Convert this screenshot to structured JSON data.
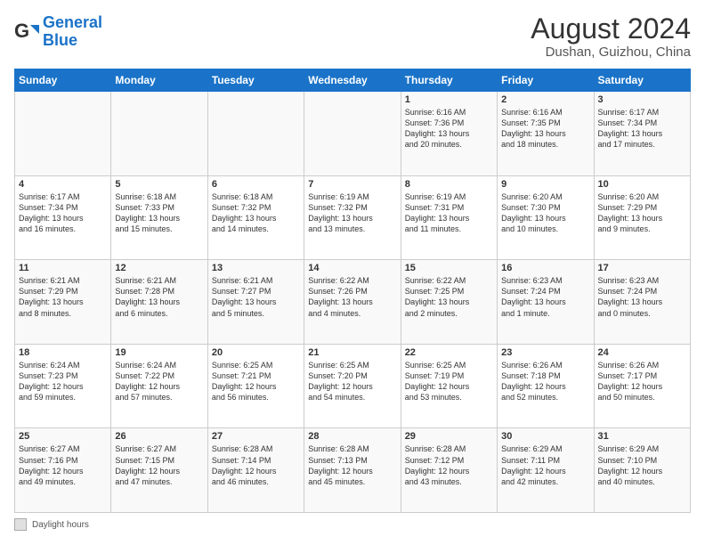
{
  "logo": {
    "general": "General",
    "blue": "Blue"
  },
  "header": {
    "title": "August 2024",
    "subtitle": "Dushan, Guizhou, China"
  },
  "days": [
    "Sunday",
    "Monday",
    "Tuesday",
    "Wednesday",
    "Thursday",
    "Friday",
    "Saturday"
  ],
  "weeks": [
    [
      {
        "day": "",
        "content": ""
      },
      {
        "day": "",
        "content": ""
      },
      {
        "day": "",
        "content": ""
      },
      {
        "day": "",
        "content": ""
      },
      {
        "day": "1",
        "content": "Sunrise: 6:16 AM\nSunset: 7:36 PM\nDaylight: 13 hours\nand 20 minutes."
      },
      {
        "day": "2",
        "content": "Sunrise: 6:16 AM\nSunset: 7:35 PM\nDaylight: 13 hours\nand 18 minutes."
      },
      {
        "day": "3",
        "content": "Sunrise: 6:17 AM\nSunset: 7:34 PM\nDaylight: 13 hours\nand 17 minutes."
      }
    ],
    [
      {
        "day": "4",
        "content": "Sunrise: 6:17 AM\nSunset: 7:34 PM\nDaylight: 13 hours\nand 16 minutes."
      },
      {
        "day": "5",
        "content": "Sunrise: 6:18 AM\nSunset: 7:33 PM\nDaylight: 13 hours\nand 15 minutes."
      },
      {
        "day": "6",
        "content": "Sunrise: 6:18 AM\nSunset: 7:32 PM\nDaylight: 13 hours\nand 14 minutes."
      },
      {
        "day": "7",
        "content": "Sunrise: 6:19 AM\nSunset: 7:32 PM\nDaylight: 13 hours\nand 13 minutes."
      },
      {
        "day": "8",
        "content": "Sunrise: 6:19 AM\nSunset: 7:31 PM\nDaylight: 13 hours\nand 11 minutes."
      },
      {
        "day": "9",
        "content": "Sunrise: 6:20 AM\nSunset: 7:30 PM\nDaylight: 13 hours\nand 10 minutes."
      },
      {
        "day": "10",
        "content": "Sunrise: 6:20 AM\nSunset: 7:29 PM\nDaylight: 13 hours\nand 9 minutes."
      }
    ],
    [
      {
        "day": "11",
        "content": "Sunrise: 6:21 AM\nSunset: 7:29 PM\nDaylight: 13 hours\nand 8 minutes."
      },
      {
        "day": "12",
        "content": "Sunrise: 6:21 AM\nSunset: 7:28 PM\nDaylight: 13 hours\nand 6 minutes."
      },
      {
        "day": "13",
        "content": "Sunrise: 6:21 AM\nSunset: 7:27 PM\nDaylight: 13 hours\nand 5 minutes."
      },
      {
        "day": "14",
        "content": "Sunrise: 6:22 AM\nSunset: 7:26 PM\nDaylight: 13 hours\nand 4 minutes."
      },
      {
        "day": "15",
        "content": "Sunrise: 6:22 AM\nSunset: 7:25 PM\nDaylight: 13 hours\nand 2 minutes."
      },
      {
        "day": "16",
        "content": "Sunrise: 6:23 AM\nSunset: 7:24 PM\nDaylight: 13 hours\nand 1 minute."
      },
      {
        "day": "17",
        "content": "Sunrise: 6:23 AM\nSunset: 7:24 PM\nDaylight: 13 hours\nand 0 minutes."
      }
    ],
    [
      {
        "day": "18",
        "content": "Sunrise: 6:24 AM\nSunset: 7:23 PM\nDaylight: 12 hours\nand 59 minutes."
      },
      {
        "day": "19",
        "content": "Sunrise: 6:24 AM\nSunset: 7:22 PM\nDaylight: 12 hours\nand 57 minutes."
      },
      {
        "day": "20",
        "content": "Sunrise: 6:25 AM\nSunset: 7:21 PM\nDaylight: 12 hours\nand 56 minutes."
      },
      {
        "day": "21",
        "content": "Sunrise: 6:25 AM\nSunset: 7:20 PM\nDaylight: 12 hours\nand 54 minutes."
      },
      {
        "day": "22",
        "content": "Sunrise: 6:25 AM\nSunset: 7:19 PM\nDaylight: 12 hours\nand 53 minutes."
      },
      {
        "day": "23",
        "content": "Sunrise: 6:26 AM\nSunset: 7:18 PM\nDaylight: 12 hours\nand 52 minutes."
      },
      {
        "day": "24",
        "content": "Sunrise: 6:26 AM\nSunset: 7:17 PM\nDaylight: 12 hours\nand 50 minutes."
      }
    ],
    [
      {
        "day": "25",
        "content": "Sunrise: 6:27 AM\nSunset: 7:16 PM\nDaylight: 12 hours\nand 49 minutes."
      },
      {
        "day": "26",
        "content": "Sunrise: 6:27 AM\nSunset: 7:15 PM\nDaylight: 12 hours\nand 47 minutes."
      },
      {
        "day": "27",
        "content": "Sunrise: 6:28 AM\nSunset: 7:14 PM\nDaylight: 12 hours\nand 46 minutes."
      },
      {
        "day": "28",
        "content": "Sunrise: 6:28 AM\nSunset: 7:13 PM\nDaylight: 12 hours\nand 45 minutes."
      },
      {
        "day": "29",
        "content": "Sunrise: 6:28 AM\nSunset: 7:12 PM\nDaylight: 12 hours\nand 43 minutes."
      },
      {
        "day": "30",
        "content": "Sunrise: 6:29 AM\nSunset: 7:11 PM\nDaylight: 12 hours\nand 42 minutes."
      },
      {
        "day": "31",
        "content": "Sunrise: 6:29 AM\nSunset: 7:10 PM\nDaylight: 12 hours\nand 40 minutes."
      }
    ]
  ],
  "footer": {
    "label": "Daylight hours"
  }
}
